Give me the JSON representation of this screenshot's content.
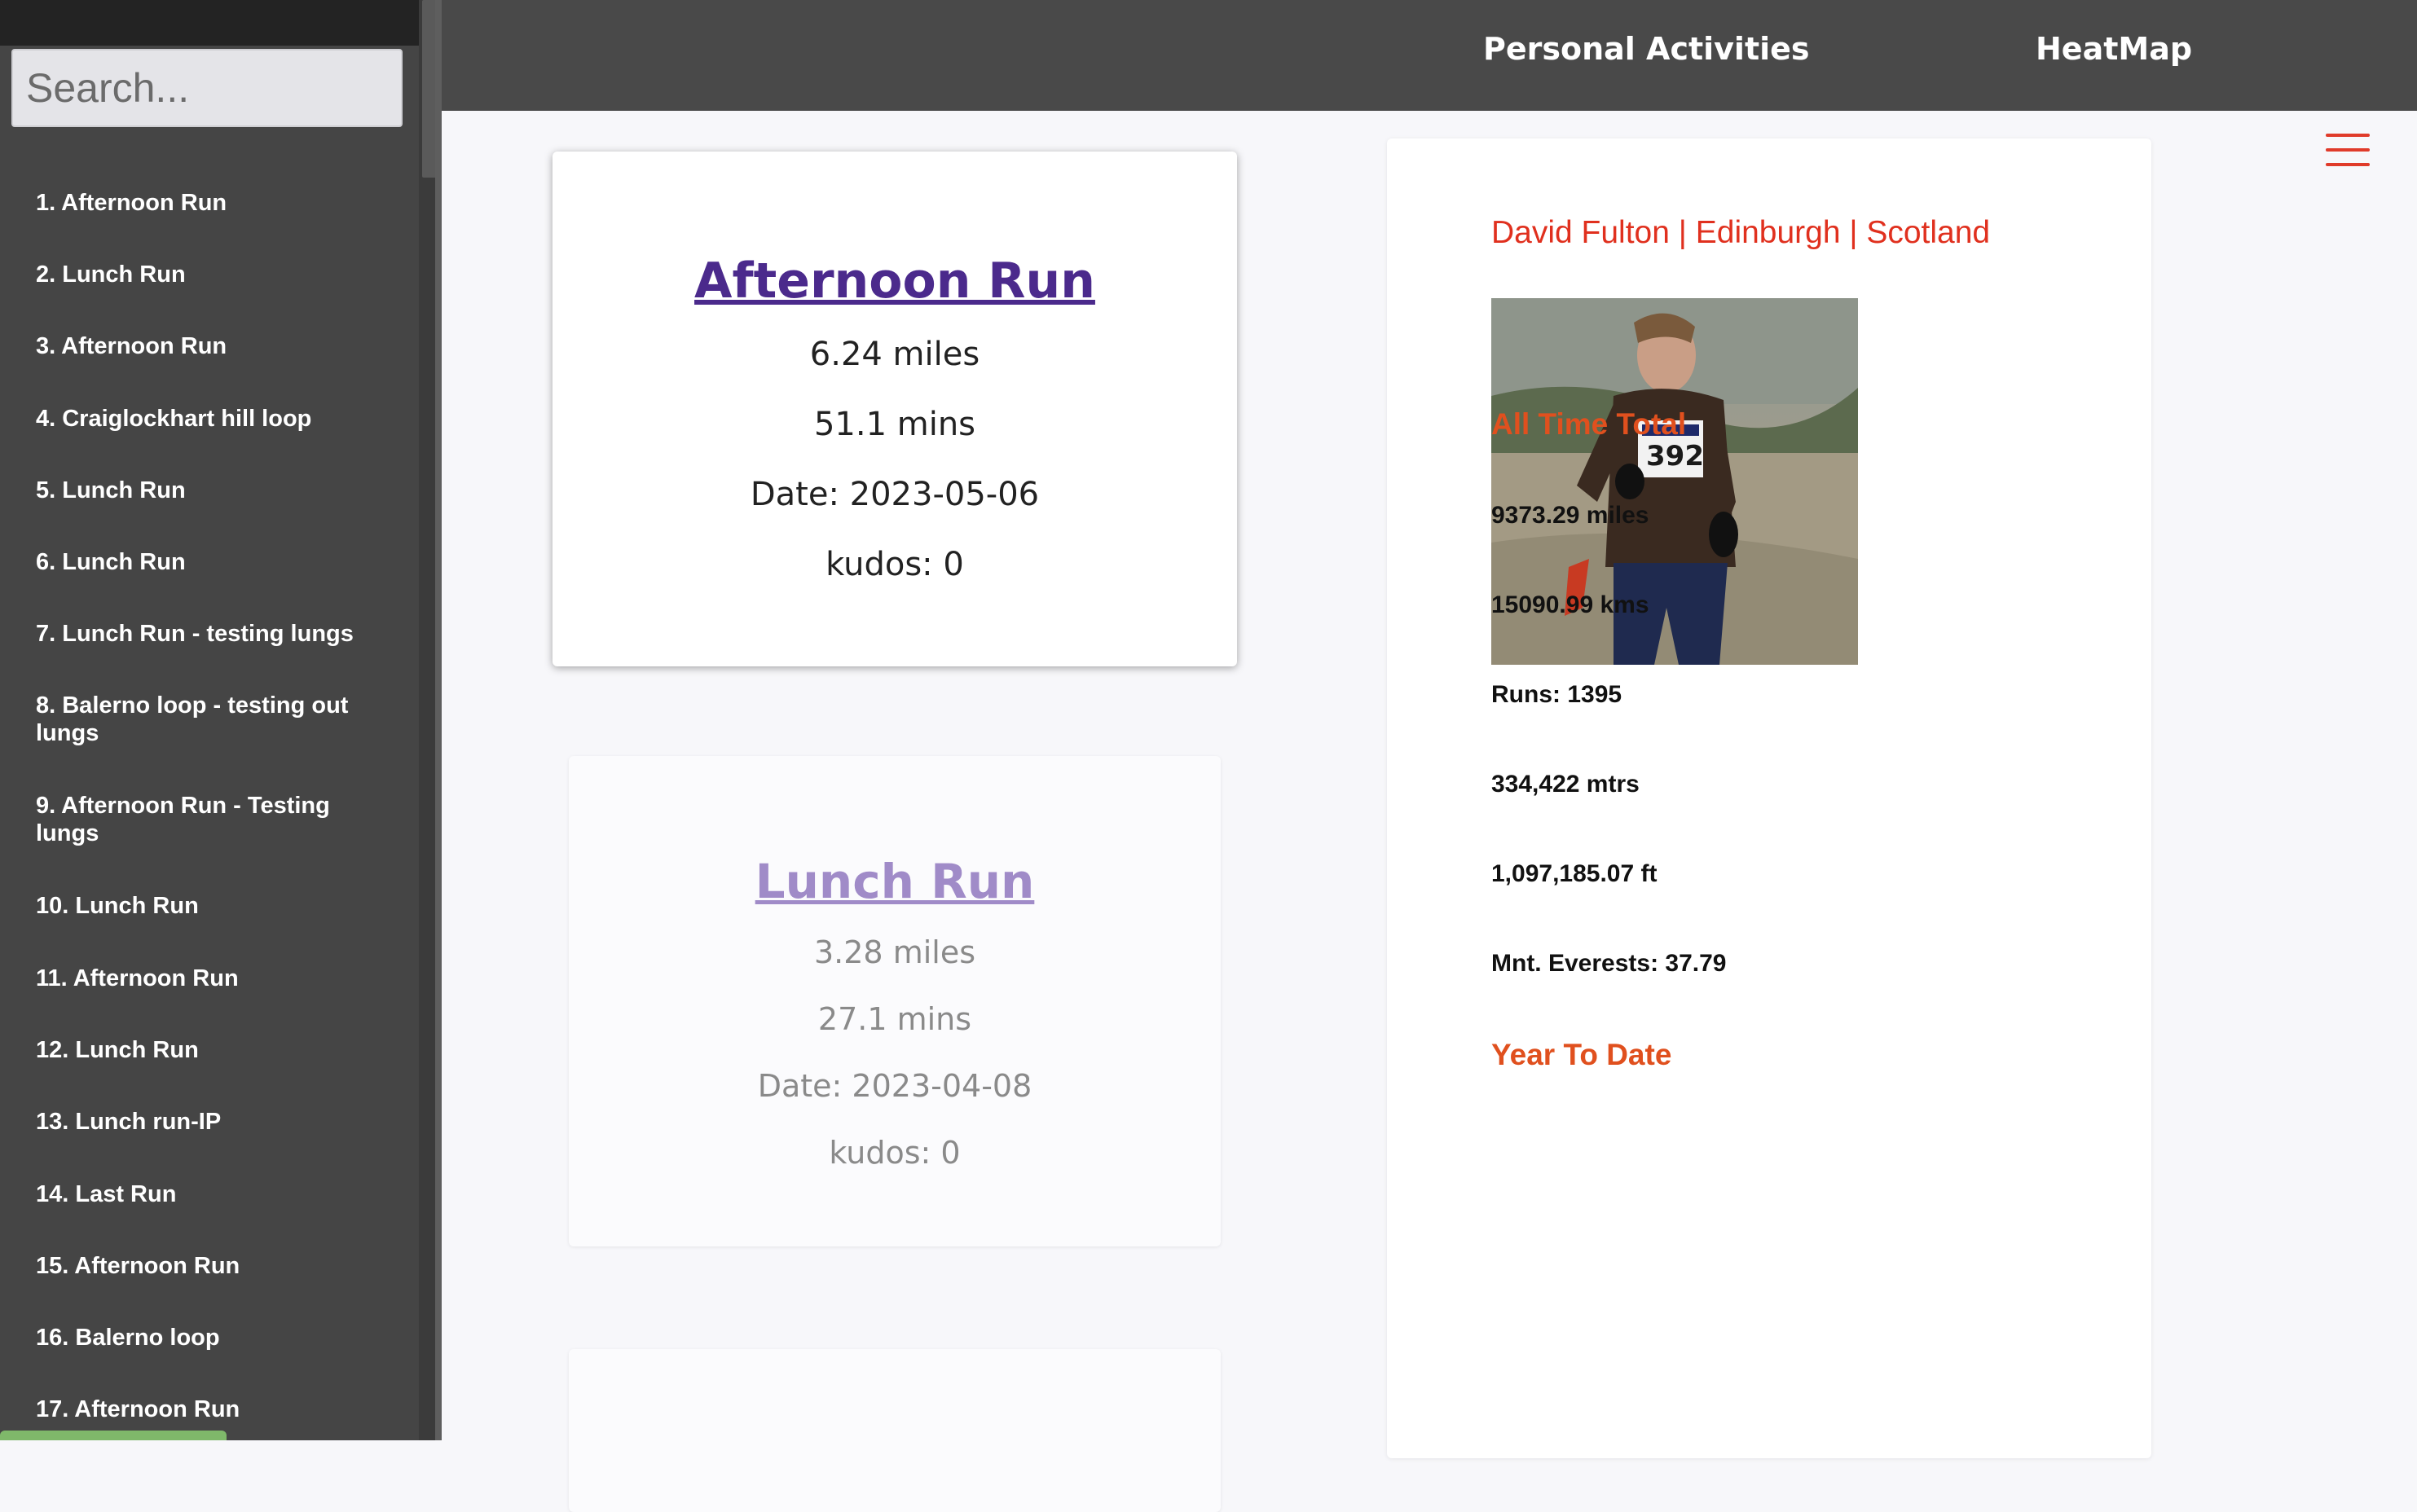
{
  "search": {
    "placeholder": "Search..."
  },
  "sidebar": {
    "items": [
      "1. Afternoon Run",
      "2. Lunch Run",
      "3. Afternoon Run",
      "4. Craiglockhart hill loop",
      "5. Lunch Run",
      "6. Lunch Run",
      "7. Lunch Run - testing lungs",
      "8. Balerno loop - testing out lungs",
      "9. Afternoon Run - Testing lungs",
      "10. Lunch Run",
      "11. Afternoon Run",
      "12. Lunch Run",
      "13. Lunch run-IP",
      "14. Last Run",
      "15. Afternoon Run",
      "16. Balerno loop",
      "17. Afternoon Run"
    ]
  },
  "nav": {
    "personal_activities": "Personal Activities",
    "heatmap": "HeatMap"
  },
  "cards": [
    {
      "title": "Afternoon Run",
      "distance": "6.24 miles",
      "duration": "51.1 mins",
      "date": "Date: 2023-05-06",
      "kudos": "kudos: 0"
    },
    {
      "title": "Lunch Run",
      "distance": "3.28 miles",
      "duration": "27.1 mins",
      "date": "Date: 2023-04-08",
      "kudos": "kudos: 0"
    }
  ],
  "profile": {
    "name": "David Fulton | Edinburgh | Scotland",
    "all_time_heading": "All Time Total",
    "miles": "9373.29 miles",
    "kms": "15090.99 kms",
    "runs": "Runs: 1395",
    "mtrs": "334,422 mtrs",
    "ft": "1,097,185.07 ft",
    "everests": "Mnt. Everests: 37.79",
    "ytd_heading": "Year To Date"
  },
  "colors": {
    "accent_red": "#e0301e",
    "heading_orange": "#e0501e",
    "link_purple": "#4b2a8c",
    "sidebar_bg": "#454545",
    "nav_bg": "#494949"
  }
}
